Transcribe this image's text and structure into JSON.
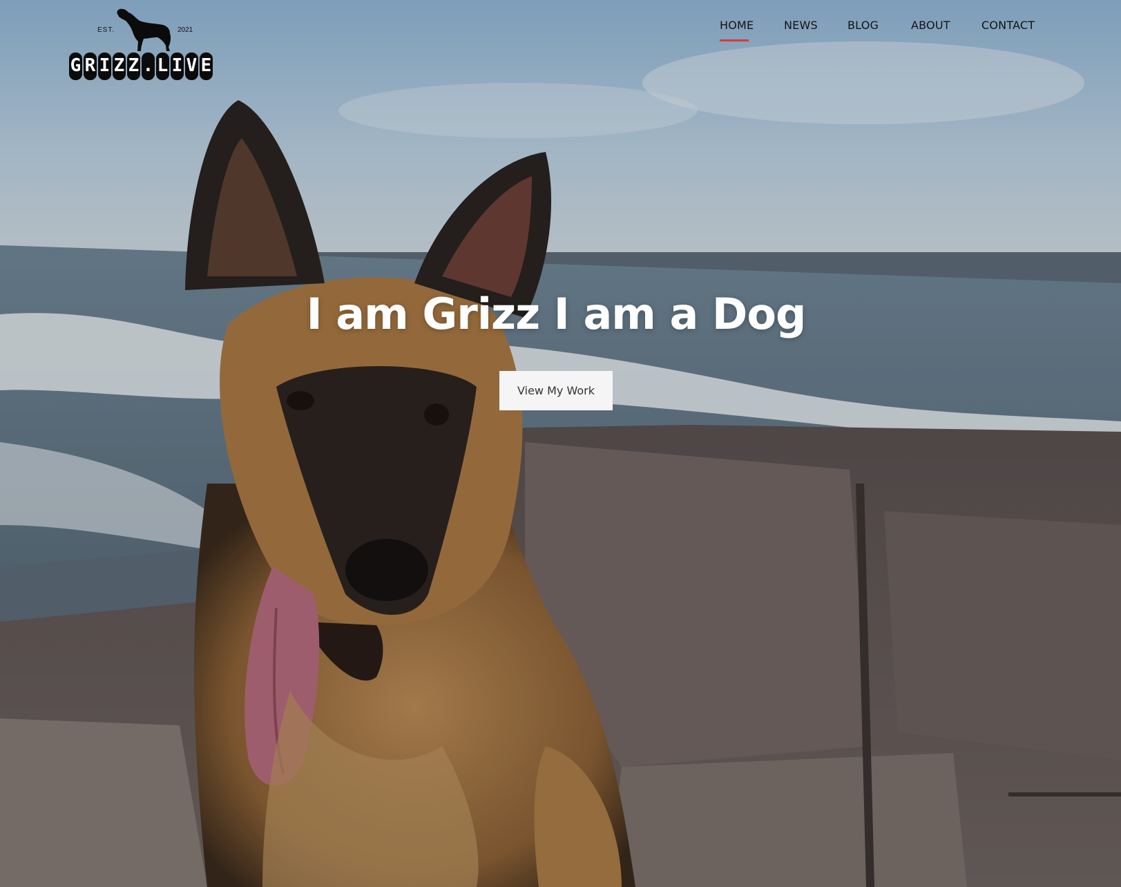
{
  "logo": {
    "est": "EST.",
    "year": "2021",
    "letters": [
      "G",
      "R",
      "I",
      "Z",
      "Z",
      ".",
      "L",
      "I",
      "V",
      "E"
    ]
  },
  "nav": {
    "home": "HOME",
    "news": "NEWS",
    "blog": "BLOG",
    "about": "ABOUT",
    "contact": "CONTACT",
    "active": "HOME",
    "active_color": "#d33c3c"
  },
  "hero": {
    "headline": "I am Grizz I am a Dog",
    "cta_label": "View My Work"
  }
}
